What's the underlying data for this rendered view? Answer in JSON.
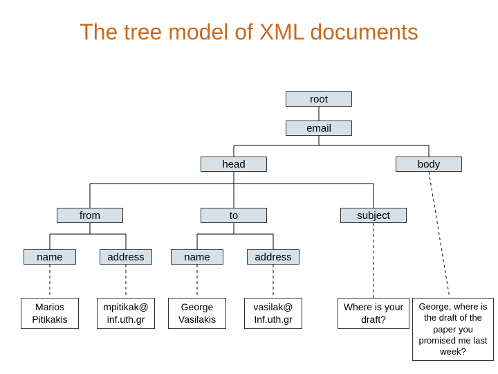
{
  "title": "The tree model of XML documents",
  "nodes": {
    "root": "root",
    "email": "email",
    "head": "head",
    "body": "body",
    "from": "from",
    "to": "to",
    "subject": "subject",
    "name1": "name",
    "address1": "address",
    "name2": "name",
    "address2": "address"
  },
  "leaves": {
    "from_name": "Marios Pitikakis",
    "from_address": "mpitikak@ inf.uth.gr",
    "to_name": "George Vasilakis",
    "to_address": "vasilak@ Inf.uth.gr",
    "subject_text": "Where is your draft?",
    "body_text": "George, where is the draft of the paper you promised me last week?"
  }
}
